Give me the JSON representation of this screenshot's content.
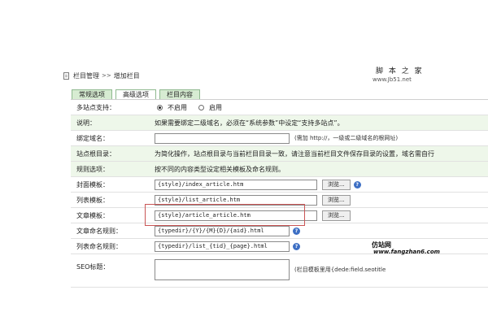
{
  "breadcrumb": {
    "root": "栏目管理",
    "separator": ">>",
    "current": "增加栏目"
  },
  "watermark_top": {
    "name": "脚 本 之 家",
    "url": "www.Jb51.net"
  },
  "tabs": [
    {
      "label": "常规选项",
      "active": false
    },
    {
      "label": "高级选项",
      "active": true
    },
    {
      "label": "栏目内容",
      "active": false
    }
  ],
  "multisite": {
    "label": "多站点支持：",
    "options": [
      {
        "label": "不启用",
        "selected": true
      },
      {
        "label": "启用",
        "selected": false
      }
    ]
  },
  "note": {
    "label": "说明：",
    "text": "如果需要绑定二级域名，必须在“系统参数”中设定“支持多站点”。"
  },
  "bind_domain": {
    "label": "绑定域名：",
    "value": "",
    "hint": "(需加 http://，一级或二级域名的根网址)"
  },
  "site_root": {
    "label": "站点根目录：",
    "text": "为简化操作，站点根目录与当前栏目目录一致，请注意当前栏目文件保存目录的设置，域名需自行"
  },
  "rules": {
    "label": "规则选项：",
    "text": "按不同的内容类型设定相关模板及命名规则。"
  },
  "templates": {
    "browse_label": "浏览...",
    "index": {
      "label": "封面模板：",
      "value": "{style}/index_article.htm"
    },
    "list": {
      "label": "列表模板：",
      "value": "{style}/list_article.htm"
    },
    "article": {
      "label": "文章模板：",
      "value": "{style}/article_article.htm"
    }
  },
  "naming": {
    "article_rule": {
      "label": "文章命名规则：",
      "value": "{typedir}/{Y}/{M}{D}/{aid}.html"
    },
    "list_rule": {
      "label": "列表命名规则：",
      "value": "{typedir}/list_{tid}_{page}.html"
    }
  },
  "seo": {
    "label": "SEO标题：",
    "value": "",
    "hint": "(栏目模板里用{dede:field.seotitle"
  },
  "watermark_bottom": {
    "name": "仿站网",
    "url": "www.fangzhan6.com"
  },
  "colors": {
    "tab_bg": "#d7ecd2",
    "row_shade": "#eef7ea",
    "highlight_border": "#c95555",
    "help_icon": "#3d6fc4"
  }
}
